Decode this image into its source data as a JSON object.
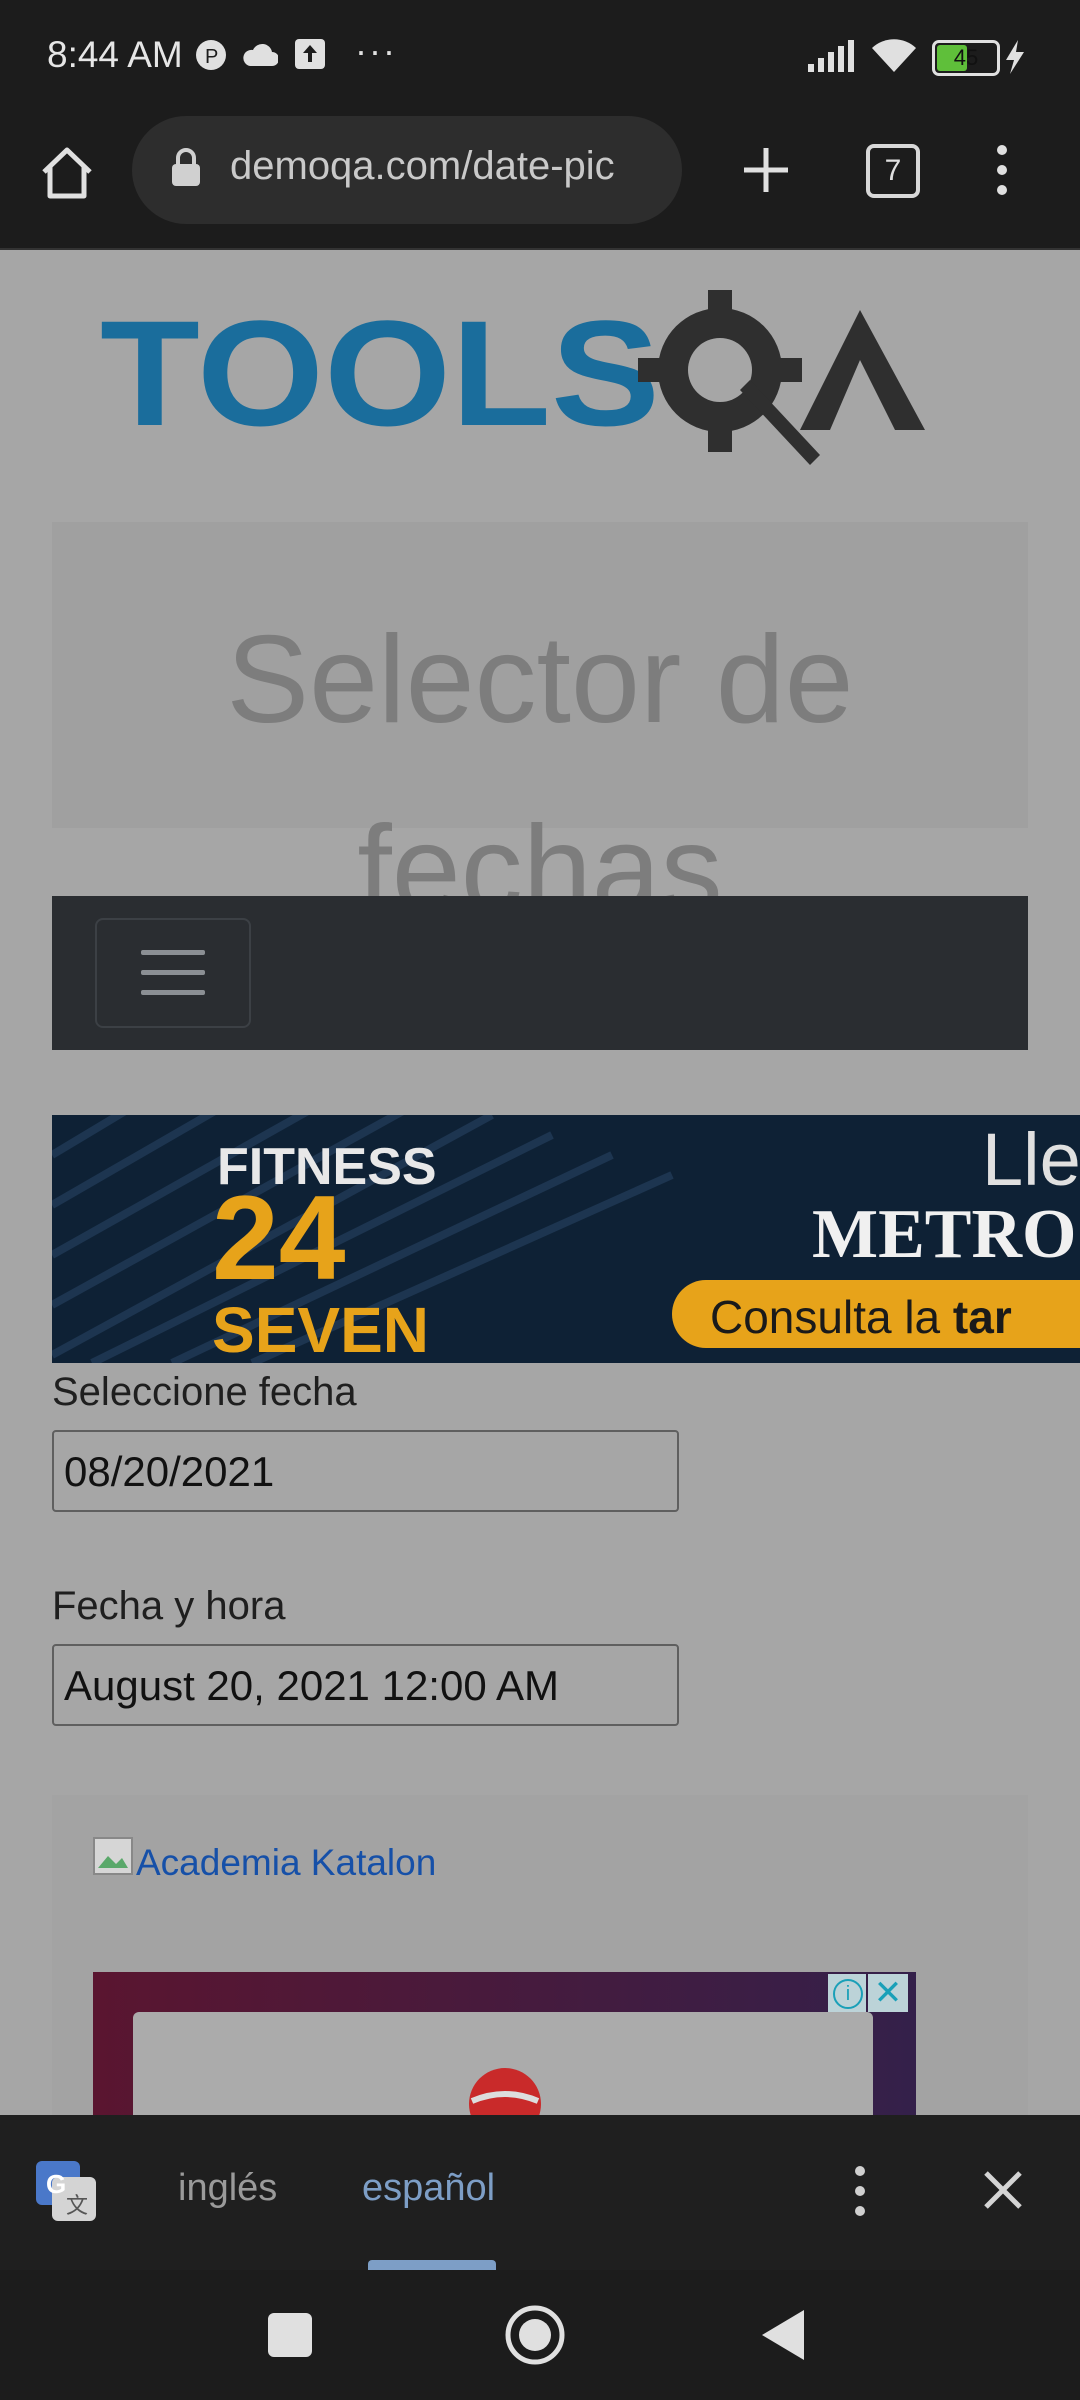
{
  "status_bar": {
    "time": "8:44 AM",
    "battery": "45",
    "icons": [
      "notification-p-icon",
      "cloud-icon",
      "upload-icon",
      "more-dots-icon",
      "signal-icon",
      "wifi-icon",
      "battery-icon",
      "charging-icon"
    ]
  },
  "browser": {
    "url": "demoqa.com/date-pic",
    "tab_count": "7"
  },
  "page": {
    "logo_text": "TOOLSQA",
    "title": "Selector de fechas",
    "ad1": {
      "brand_line1": "FITNESS",
      "brand_line2": "24",
      "brand_line3": "SEVEN",
      "headline_partial": "Lle",
      "subline_partial": "METRO",
      "cta_partial_a": "Consulta la ",
      "cta_partial_b": "tar"
    },
    "select_date_label": "Seleccione fecha",
    "select_date_value": "08/20/2021",
    "date_time_label": "Fecha y hora",
    "date_time_value": "August 20, 2021 12:00 AM",
    "katalon_link": "Academia Katalon"
  },
  "translate_bar": {
    "lang_source": "inglés",
    "lang_target": "español"
  },
  "colors": {
    "accent": "#7d9ec6",
    "toolsqa_blue": "#1a6d9c"
  }
}
